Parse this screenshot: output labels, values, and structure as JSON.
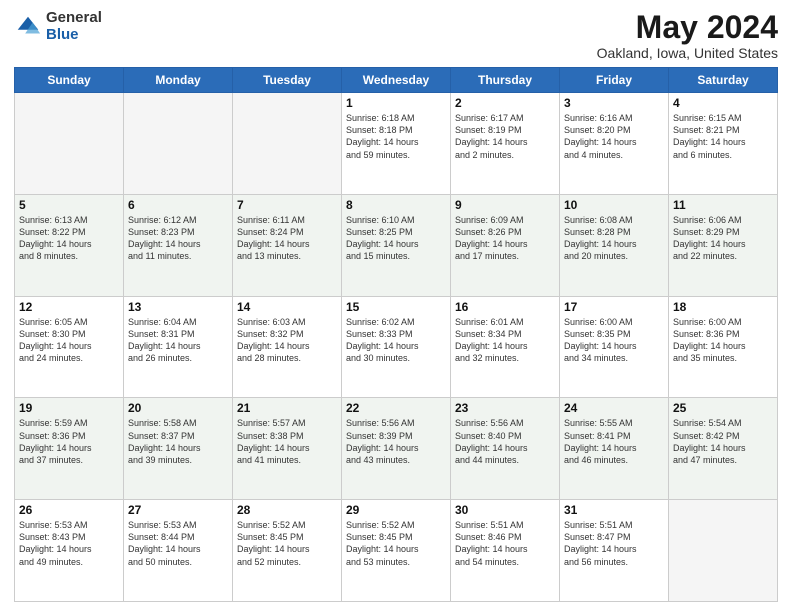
{
  "logo": {
    "general": "General",
    "blue": "Blue"
  },
  "header": {
    "title": "May 2024",
    "location": "Oakland, Iowa, United States"
  },
  "days_of_week": [
    "Sunday",
    "Monday",
    "Tuesday",
    "Wednesday",
    "Thursday",
    "Friday",
    "Saturday"
  ],
  "weeks": [
    [
      {
        "day": "",
        "info": ""
      },
      {
        "day": "",
        "info": ""
      },
      {
        "day": "",
        "info": ""
      },
      {
        "day": "1",
        "info": "Sunrise: 6:18 AM\nSunset: 8:18 PM\nDaylight: 14 hours\nand 59 minutes."
      },
      {
        "day": "2",
        "info": "Sunrise: 6:17 AM\nSunset: 8:19 PM\nDaylight: 14 hours\nand 2 minutes."
      },
      {
        "day": "3",
        "info": "Sunrise: 6:16 AM\nSunset: 8:20 PM\nDaylight: 14 hours\nand 4 minutes."
      },
      {
        "day": "4",
        "info": "Sunrise: 6:15 AM\nSunset: 8:21 PM\nDaylight: 14 hours\nand 6 minutes."
      }
    ],
    [
      {
        "day": "5",
        "info": "Sunrise: 6:13 AM\nSunset: 8:22 PM\nDaylight: 14 hours\nand 8 minutes."
      },
      {
        "day": "6",
        "info": "Sunrise: 6:12 AM\nSunset: 8:23 PM\nDaylight: 14 hours\nand 11 minutes."
      },
      {
        "day": "7",
        "info": "Sunrise: 6:11 AM\nSunset: 8:24 PM\nDaylight: 14 hours\nand 13 minutes."
      },
      {
        "day": "8",
        "info": "Sunrise: 6:10 AM\nSunset: 8:25 PM\nDaylight: 14 hours\nand 15 minutes."
      },
      {
        "day": "9",
        "info": "Sunrise: 6:09 AM\nSunset: 8:26 PM\nDaylight: 14 hours\nand 17 minutes."
      },
      {
        "day": "10",
        "info": "Sunrise: 6:08 AM\nSunset: 8:28 PM\nDaylight: 14 hours\nand 20 minutes."
      },
      {
        "day": "11",
        "info": "Sunrise: 6:06 AM\nSunset: 8:29 PM\nDaylight: 14 hours\nand 22 minutes."
      }
    ],
    [
      {
        "day": "12",
        "info": "Sunrise: 6:05 AM\nSunset: 8:30 PM\nDaylight: 14 hours\nand 24 minutes."
      },
      {
        "day": "13",
        "info": "Sunrise: 6:04 AM\nSunset: 8:31 PM\nDaylight: 14 hours\nand 26 minutes."
      },
      {
        "day": "14",
        "info": "Sunrise: 6:03 AM\nSunset: 8:32 PM\nDaylight: 14 hours\nand 28 minutes."
      },
      {
        "day": "15",
        "info": "Sunrise: 6:02 AM\nSunset: 8:33 PM\nDaylight: 14 hours\nand 30 minutes."
      },
      {
        "day": "16",
        "info": "Sunrise: 6:01 AM\nSunset: 8:34 PM\nDaylight: 14 hours\nand 32 minutes."
      },
      {
        "day": "17",
        "info": "Sunrise: 6:00 AM\nSunset: 8:35 PM\nDaylight: 14 hours\nand 34 minutes."
      },
      {
        "day": "18",
        "info": "Sunrise: 6:00 AM\nSunset: 8:36 PM\nDaylight: 14 hours\nand 35 minutes."
      }
    ],
    [
      {
        "day": "19",
        "info": "Sunrise: 5:59 AM\nSunset: 8:36 PM\nDaylight: 14 hours\nand 37 minutes."
      },
      {
        "day": "20",
        "info": "Sunrise: 5:58 AM\nSunset: 8:37 PM\nDaylight: 14 hours\nand 39 minutes."
      },
      {
        "day": "21",
        "info": "Sunrise: 5:57 AM\nSunset: 8:38 PM\nDaylight: 14 hours\nand 41 minutes."
      },
      {
        "day": "22",
        "info": "Sunrise: 5:56 AM\nSunset: 8:39 PM\nDaylight: 14 hours\nand 43 minutes."
      },
      {
        "day": "23",
        "info": "Sunrise: 5:56 AM\nSunset: 8:40 PM\nDaylight: 14 hours\nand 44 minutes."
      },
      {
        "day": "24",
        "info": "Sunrise: 5:55 AM\nSunset: 8:41 PM\nDaylight: 14 hours\nand 46 minutes."
      },
      {
        "day": "25",
        "info": "Sunrise: 5:54 AM\nSunset: 8:42 PM\nDaylight: 14 hours\nand 47 minutes."
      }
    ],
    [
      {
        "day": "26",
        "info": "Sunrise: 5:53 AM\nSunset: 8:43 PM\nDaylight: 14 hours\nand 49 minutes."
      },
      {
        "day": "27",
        "info": "Sunrise: 5:53 AM\nSunset: 8:44 PM\nDaylight: 14 hours\nand 50 minutes."
      },
      {
        "day": "28",
        "info": "Sunrise: 5:52 AM\nSunset: 8:45 PM\nDaylight: 14 hours\nand 52 minutes."
      },
      {
        "day": "29",
        "info": "Sunrise: 5:52 AM\nSunset: 8:45 PM\nDaylight: 14 hours\nand 53 minutes."
      },
      {
        "day": "30",
        "info": "Sunrise: 5:51 AM\nSunset: 8:46 PM\nDaylight: 14 hours\nand 54 minutes."
      },
      {
        "day": "31",
        "info": "Sunrise: 5:51 AM\nSunset: 8:47 PM\nDaylight: 14 hours\nand 56 minutes."
      },
      {
        "day": "",
        "info": ""
      }
    ]
  ]
}
